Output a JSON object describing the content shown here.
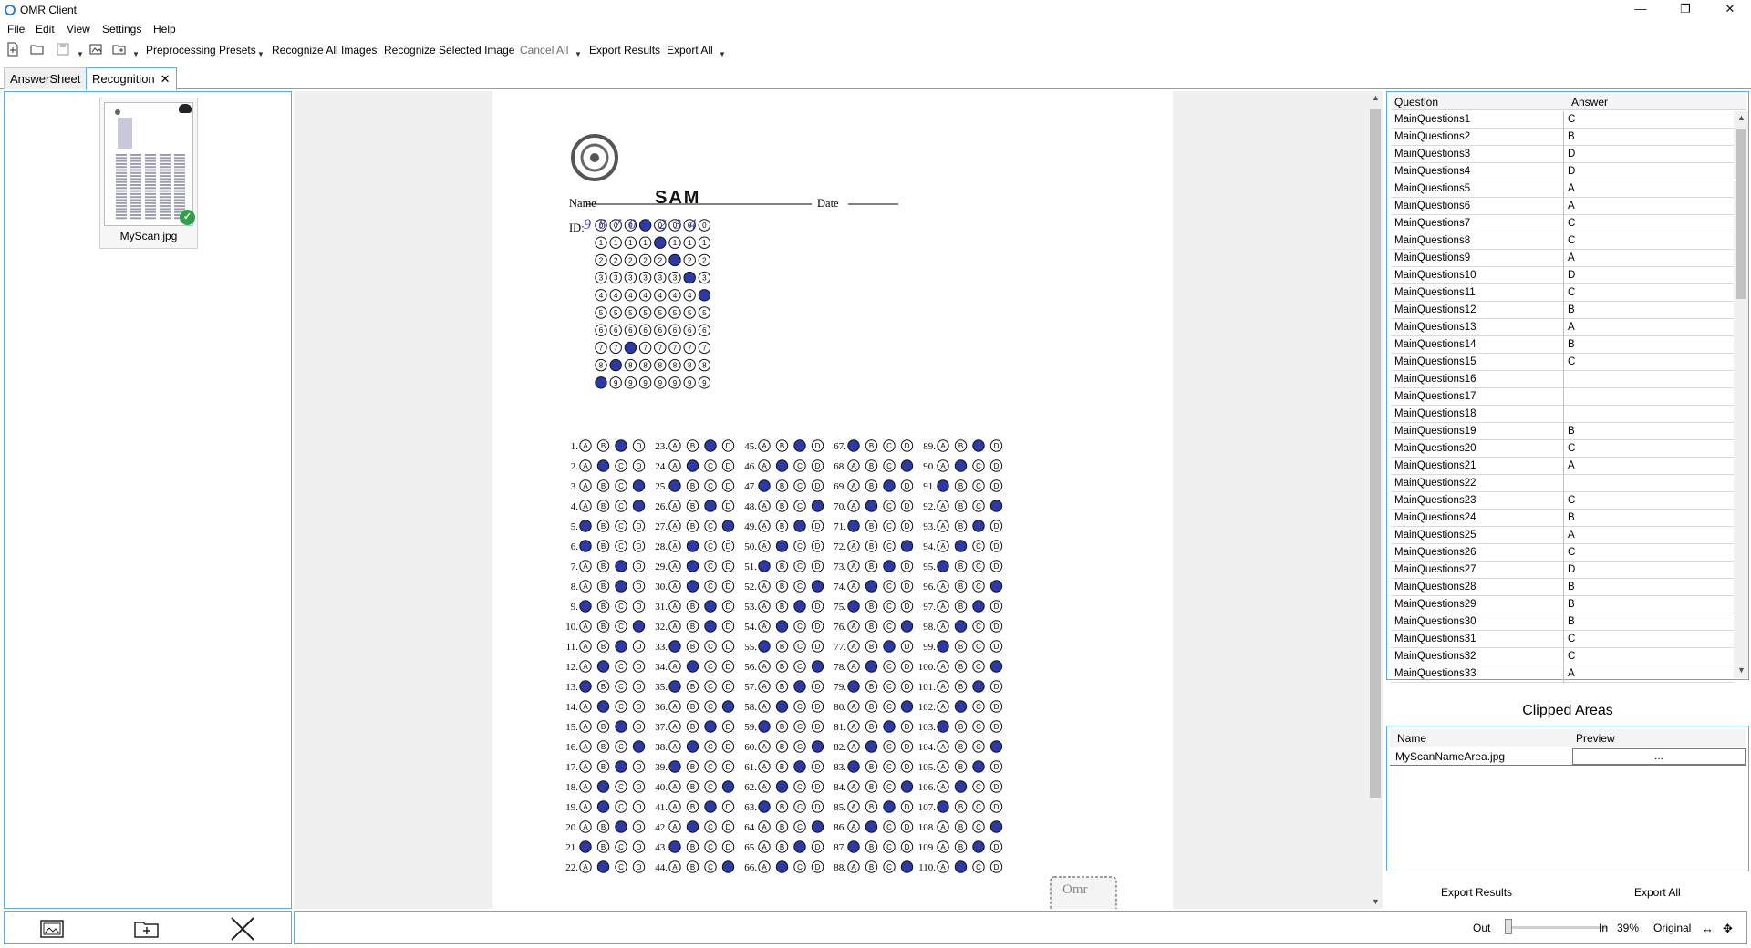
{
  "window": {
    "title": "OMR Client",
    "minimize": "—",
    "maximize": "❐",
    "close": "✕"
  },
  "menu": [
    "File",
    "Edit",
    "View",
    "Settings",
    "Help"
  ],
  "toolbar": {
    "preprocessing_presets": "Preprocessing Presets",
    "recognize_all": "Recognize All Images",
    "recognize_selected": "Recognize Selected Image",
    "cancel_all": "Cancel All",
    "export_results": "Export Results",
    "export_all": "Export All"
  },
  "tabs": {
    "answersheet": "AnswerSheet",
    "recognition": "Recognition",
    "close": "✕"
  },
  "images": {
    "thumb_caption": "MyScan.jpg",
    "check": "✓"
  },
  "sheet": {
    "name_label": "Name",
    "name_value": "SAM",
    "date_label": "Date",
    "id_label": "ID:",
    "id_digits": [
      "9",
      "8",
      "7",
      "0",
      "1",
      "2",
      "3",
      "4"
    ],
    "stamp": "Omr"
  },
  "answers_grid": {
    "headers": {
      "question": "Question",
      "answer": "Answer"
    },
    "rows": [
      {
        "q": "MainQuestions1",
        "a": "C"
      },
      {
        "q": "MainQuestions2",
        "a": "B"
      },
      {
        "q": "MainQuestions3",
        "a": "D"
      },
      {
        "q": "MainQuestions4",
        "a": "D"
      },
      {
        "q": "MainQuestions5",
        "a": "A"
      },
      {
        "q": "MainQuestions6",
        "a": "A"
      },
      {
        "q": "MainQuestions7",
        "a": "C"
      },
      {
        "q": "MainQuestions8",
        "a": "C"
      },
      {
        "q": "MainQuestions9",
        "a": "A"
      },
      {
        "q": "MainQuestions10",
        "a": "D"
      },
      {
        "q": "MainQuestions11",
        "a": "C"
      },
      {
        "q": "MainQuestions12",
        "a": "B"
      },
      {
        "q": "MainQuestions13",
        "a": "A"
      },
      {
        "q": "MainQuestions14",
        "a": "B"
      },
      {
        "q": "MainQuestions15",
        "a": "C"
      },
      {
        "q": "MainQuestions16",
        "a": ""
      },
      {
        "q": "MainQuestions17",
        "a": ""
      },
      {
        "q": "MainQuestions18",
        "a": ""
      },
      {
        "q": "MainQuestions19",
        "a": "B"
      },
      {
        "q": "MainQuestions20",
        "a": "C"
      },
      {
        "q": "MainQuestions21",
        "a": "A"
      },
      {
        "q": "MainQuestions22",
        "a": ""
      },
      {
        "q": "MainQuestions23",
        "a": "C"
      },
      {
        "q": "MainQuestions24",
        "a": "B"
      },
      {
        "q": "MainQuestions25",
        "a": "A"
      },
      {
        "q": "MainQuestions26",
        "a": "C"
      },
      {
        "q": "MainQuestions27",
        "a": "D"
      },
      {
        "q": "MainQuestions28",
        "a": "B"
      },
      {
        "q": "MainQuestions29",
        "a": "B"
      },
      {
        "q": "MainQuestions30",
        "a": "B"
      },
      {
        "q": "MainQuestions31",
        "a": "C"
      },
      {
        "q": "MainQuestions32",
        "a": "C"
      },
      {
        "q": "MainQuestions33",
        "a": "A"
      }
    ]
  },
  "clipped": {
    "title": "Clipped Areas",
    "headers": {
      "name": "Name",
      "preview": "Preview"
    },
    "rows": [
      {
        "name": "MyScanNameArea.jpg",
        "preview": "..."
      }
    ]
  },
  "right_footer": {
    "export_results": "Export Results",
    "export_all": "Export All"
  },
  "statusbar": {
    "out": "Out",
    "in": "In",
    "zoom": "39%",
    "original": "Original"
  },
  "colors": {
    "accent": "#62a8e6",
    "mark": "#2b3aa8"
  }
}
